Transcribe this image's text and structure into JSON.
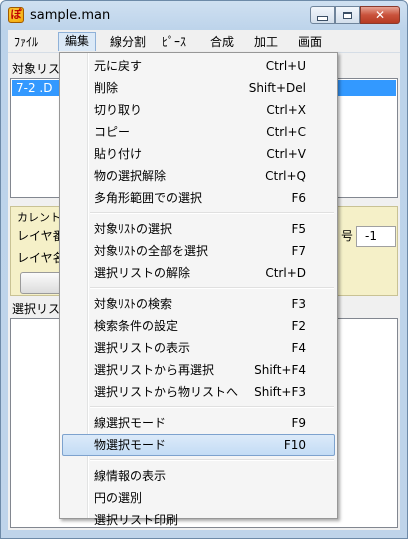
{
  "window": {
    "title": "sample.man",
    "app_icon_glyph": "ぽ",
    "icons": [
      "app-icon",
      "minimize-icon",
      "maximize-icon",
      "close-icon"
    ]
  },
  "menubar": {
    "items": [
      "ﾌｧｲﾙ",
      "編集",
      "線分割",
      "ﾋﾟｰｽ",
      "合成",
      "加工",
      "画面"
    ],
    "active": "編集"
  },
  "main": {
    "target_list_label": "対象リス",
    "target_list_selected": " 7-2 .D",
    "current_label": "カレント",
    "layer_number_label": "レイヤ番",
    "layer_name_label": "レイヤ名",
    "number_suffix_label": "号",
    "number_value": "-1",
    "selection_list_label": "選択リス"
  },
  "edit_menu": {
    "groups": [
      [
        {
          "label": "元に戻す",
          "shortcut": "Ctrl+U"
        },
        {
          "label": "削除",
          "shortcut": "Shift+Del"
        },
        {
          "label": "切り取り",
          "shortcut": "Ctrl+X"
        },
        {
          "label": "コピー",
          "shortcut": "Ctrl+C"
        },
        {
          "label": "貼り付け",
          "shortcut": "Ctrl+V"
        },
        {
          "label": "物の選択解除",
          "shortcut": "Ctrl+Q"
        },
        {
          "label": "多角形範囲での選択",
          "shortcut": "F6"
        }
      ],
      [
        {
          "label": "対象ﾘｽﾄの選択",
          "shortcut": "F5"
        },
        {
          "label": "対象ﾘｽﾄの全部を選択",
          "shortcut": "F7"
        },
        {
          "label": "選択リストの解除",
          "shortcut": "Ctrl+D"
        }
      ],
      [
        {
          "label": "対象ﾘｽﾄの検索",
          "shortcut": "F3"
        },
        {
          "label": "検索条件の設定",
          "shortcut": "F2"
        },
        {
          "label": "選択リストの表示",
          "shortcut": "F4"
        },
        {
          "label": "選択リストから再選択",
          "shortcut": "Shift+F4"
        },
        {
          "label": "選択リストから物リストへ",
          "shortcut": "Shift+F3"
        }
      ],
      [
        {
          "label": "線選択モード",
          "shortcut": "F9"
        },
        {
          "label": "物選択モード",
          "shortcut": "F10",
          "highlighted": true
        }
      ],
      [
        {
          "label": "線情報の表示",
          "shortcut": ""
        },
        {
          "label": "円の選別",
          "shortcut": ""
        },
        {
          "label": "選択リスト印刷",
          "shortcut": ""
        }
      ]
    ]
  },
  "colors": {
    "selection": "#3399ff",
    "menu_highlight": "#c3dcf5",
    "close_button": "#c9523c",
    "current_panel": "#f5f0c8"
  }
}
